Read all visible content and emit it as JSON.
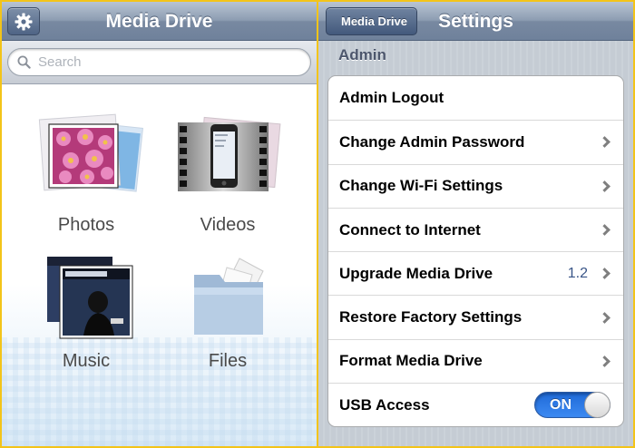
{
  "left": {
    "title": "Media Drive",
    "settings_icon": "gear-icon",
    "search": {
      "placeholder": "Search"
    },
    "tiles": [
      {
        "label": "Photos",
        "icon": "photos-icon"
      },
      {
        "label": "Videos",
        "icon": "videos-icon"
      },
      {
        "label": "Music",
        "icon": "music-icon"
      },
      {
        "label": "Files",
        "icon": "files-icon"
      }
    ]
  },
  "right": {
    "back_label": "Media Drive",
    "title": "Settings",
    "section": "Admin",
    "rows": [
      {
        "label": "Admin Logout"
      },
      {
        "label": "Change Admin Password"
      },
      {
        "label": "Change Wi-Fi Settings"
      },
      {
        "label": "Connect to Internet"
      },
      {
        "label": "Upgrade Media Drive",
        "value": "1.2"
      },
      {
        "label": "Restore Factory Settings"
      },
      {
        "label": "Format Media Drive"
      },
      {
        "label": "USB Access",
        "toggle": "ON"
      }
    ]
  },
  "colors": {
    "nav_blue": "#7889a1",
    "toggle_on": "#2f7ae6",
    "detail_text": "#385487",
    "frame": "#f3c419"
  }
}
